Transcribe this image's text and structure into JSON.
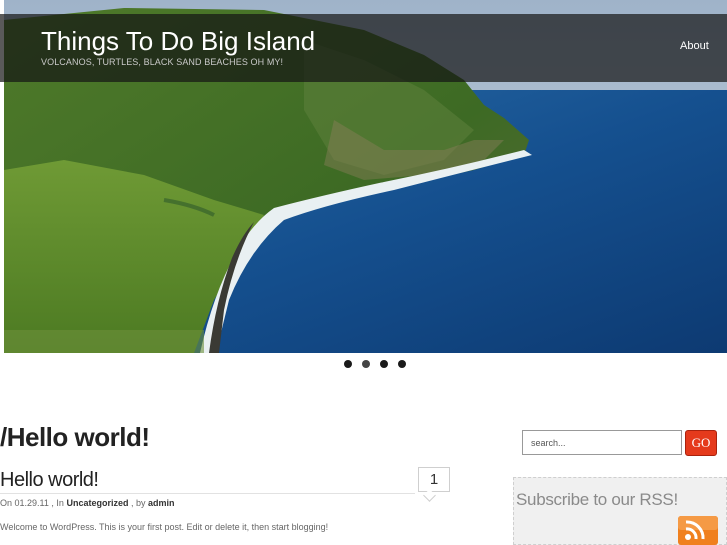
{
  "site": {
    "title": "Things To Do Big Island",
    "tagline": "VOLCANOS, TURTLES, BLACK SAND BEACHES OH MY!"
  },
  "nav": {
    "items": [
      {
        "label": "About"
      }
    ]
  },
  "slider": {
    "dot_count": 4,
    "active_index": 1,
    "image": "waipio-valley-coastline"
  },
  "page": {
    "heading": "/Hello world!"
  },
  "post": {
    "title": "Hello world!",
    "comment_count": "1",
    "meta": {
      "prefix": "On",
      "date": "01.29.11",
      "in_label": ", In",
      "category": "Uncategorized",
      "by_label": ", by",
      "author": "admin"
    },
    "excerpt": "Welcome to WordPress. This is your first post. Edit or delete it, then start blogging!"
  },
  "sidebar": {
    "search": {
      "placeholder": "search...",
      "button_label": "GO"
    },
    "rss": {
      "title": "Subscribe to our RSS!",
      "icon": "rss-feed-icon"
    }
  },
  "colors": {
    "go_button": "#e53a1c",
    "rss_orange": "#f0801e",
    "header_overlay": "#141414"
  }
}
